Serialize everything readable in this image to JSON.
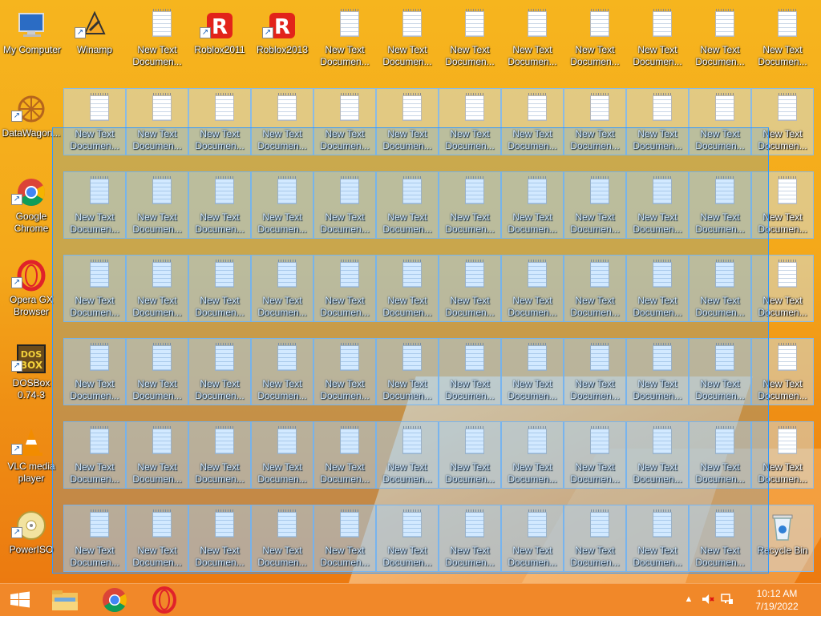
{
  "desktop": {
    "top_icons": [
      {
        "name": "my-computer",
        "label": "My Computer",
        "icon": "computer-icon"
      },
      {
        "name": "winamp",
        "label": "Winamp",
        "icon": "winamp-icon"
      },
      {
        "name": "text-doc",
        "label": "New Text\nDocumen...",
        "icon": "text-document-icon"
      },
      {
        "name": "roblox2011",
        "label": "Roblox2011",
        "icon": "roblox-icon"
      },
      {
        "name": "roblox2013",
        "label": "Roblox2013",
        "icon": "roblox-icon"
      },
      {
        "name": "text-doc",
        "label": "New Text\nDocumen...",
        "icon": "text-document-icon"
      },
      {
        "name": "text-doc",
        "label": "New Text\nDocumen...",
        "icon": "text-document-icon"
      },
      {
        "name": "text-doc",
        "label": "New Text\nDocumen...",
        "icon": "text-document-icon"
      },
      {
        "name": "text-doc",
        "label": "New Text\nDocumen...",
        "icon": "text-document-icon"
      },
      {
        "name": "text-doc",
        "label": "New Text\nDocumen...",
        "icon": "text-document-icon"
      },
      {
        "name": "text-doc",
        "label": "New Text\nDocumen...",
        "icon": "text-document-icon"
      },
      {
        "name": "text-doc",
        "label": "New Text\nDocumen...",
        "icon": "text-document-icon"
      },
      {
        "name": "text-doc",
        "label": "New Text\nDocumen...",
        "icon": "text-document-icon"
      }
    ],
    "left_icons": [
      {
        "name": "datawagon",
        "label": "DataWagon...",
        "icon": "datawagon-icon"
      },
      {
        "name": "google-chrome",
        "label": "Google\nChrome",
        "icon": "chrome-icon"
      },
      {
        "name": "opera-gx",
        "label": "Opera GX\nBrowser",
        "icon": "opera-icon"
      },
      {
        "name": "dosbox",
        "label": "DOSBox\n0.74-3",
        "icon": "dosbox-icon"
      },
      {
        "name": "vlc",
        "label": "VLC media\nplayer",
        "icon": "vlc-icon"
      },
      {
        "name": "poweriso",
        "label": "PowerISO",
        "icon": "poweriso-icon"
      }
    ],
    "grid_label": "New Text\nDocumen...",
    "recycle_bin_label": "Recycle Bin"
  },
  "taskbar": {
    "start": "windows-start-icon",
    "pinned": [
      "file-explorer-icon",
      "chrome-icon",
      "opera-icon"
    ],
    "clock_time": "10:12 AM",
    "clock_date": "7/19/2022"
  },
  "colors": {
    "taskbar": "#f07e17",
    "selection": "#3399ff",
    "wallpaper": "#f4a81a"
  }
}
